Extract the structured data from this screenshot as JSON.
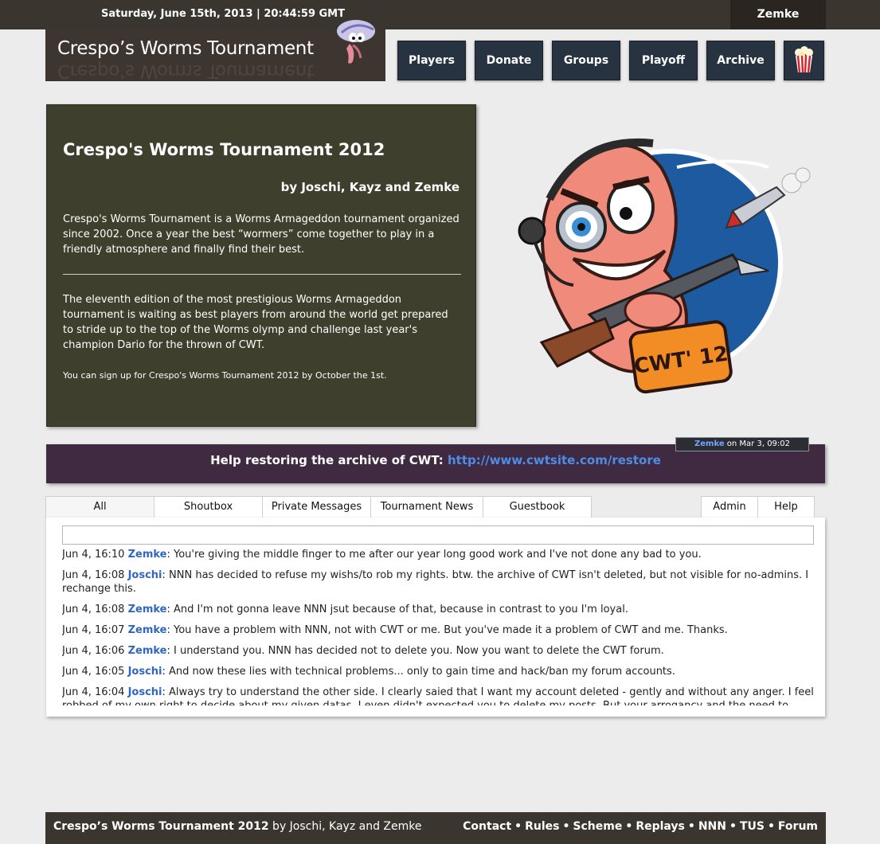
{
  "topbar": {
    "datetime": "Saturday, June 15th, 2013 | 20:44:59 GMT",
    "username": "Zemke"
  },
  "logo": {
    "text": "Crespo’s Worms Tournament",
    "home_link": "Hi"
  },
  "nav": [
    {
      "label": "Players"
    },
    {
      "label": "Donate"
    },
    {
      "label": "Groups"
    },
    {
      "label": "Playoff"
    },
    {
      "label": "Archive"
    }
  ],
  "nav_icon": "popcorn-icon",
  "intro": {
    "title": "Crespo's Worms Tournament 2012",
    "authors": "by Joschi, Kayz and Zemke",
    "paragraph1": "Crespo's Worms Tournament is a Worms Armageddon tournament organized since 2002. Once a year the best “wormers” come together to play in a friendly atmosphere and finally find their best.",
    "paragraph2": "The eleventh edition of the most prestigious Worms Armageddon tournament is waiting as best players from around the world get prepared to stride up to the top of the Worms olymp and challenge last year's champion Dario for the thrown of CWT.",
    "signup": "You can sign up for Crespo's Worms Tournament 2012 by October the 1st."
  },
  "mascot": {
    "badge_text": "CWT' 12"
  },
  "announcement": {
    "meta_author": "Zemke",
    "meta_date": " on Mar 3, 09:02",
    "text": "Help restoring the archive of CWT: ",
    "link": "http://www.cwtsite.com/restore"
  },
  "tabs_left": [
    {
      "label": "All",
      "active": true
    },
    {
      "label": "Shoutbox"
    },
    {
      "label": "Private Messages"
    },
    {
      "label": "Tournament News"
    },
    {
      "label": "Guestbook"
    }
  ],
  "tabs_right": [
    {
      "label": "Admin"
    },
    {
      "label": "Help"
    }
  ],
  "shoutbox": {
    "input_value": "",
    "messages": [
      {
        "time": "Jun 4, 16:10",
        "author": "Zemke",
        "text": ": You're giving the middle finger to me after our year long good work and I've not done any bad to you."
      },
      {
        "time": "Jun 4, 16:08",
        "author": "Joschi",
        "text": ": NNN has decided to refuse my wishs/to rob my rights. btw. the archive of CWT isn't deleted, but not visible for no-admins. I rechange this."
      },
      {
        "time": "Jun 4, 16:08",
        "author": "Zemke",
        "text": ": And I'm not gonna leave NNN jsut because of that, because in contrast to you I'm loyal."
      },
      {
        "time": "Jun 4, 16:07",
        "author": "Zemke",
        "text": ": You have a problem with NNN, not with CWT or me. But you've made it a problem of CWT and me. Thanks."
      },
      {
        "time": "Jun 4, 16:06",
        "author": "Zemke",
        "text": ": I understand you. NNN has decided not to delete you. Now you want to delete the CWT forum."
      },
      {
        "time": "Jun 4, 16:05",
        "author": "Joschi",
        "text": ": And now these lies with technical problems... only to gain time and hack/ban my forum accounts."
      },
      {
        "time": "Jun 4, 16:04",
        "author": "Joschi",
        "text": ": Always try to understand the other side. I clearly saied that I want my account deleted - gently and without any anger. I feel robbed of my own right to decide about my given datas. I even didn't expected you to delete my posts. But your arrogancy and the need to"
      }
    ]
  },
  "footer": {
    "title": "Crespo’s Worms Tournament 2012",
    "authors": " by Joschi, Kayz and Zemke",
    "separator": "•",
    "links": [
      "Contact",
      "Rules",
      "Scheme",
      "Replays",
      "NNN",
      "TUS",
      "Forum"
    ]
  }
}
